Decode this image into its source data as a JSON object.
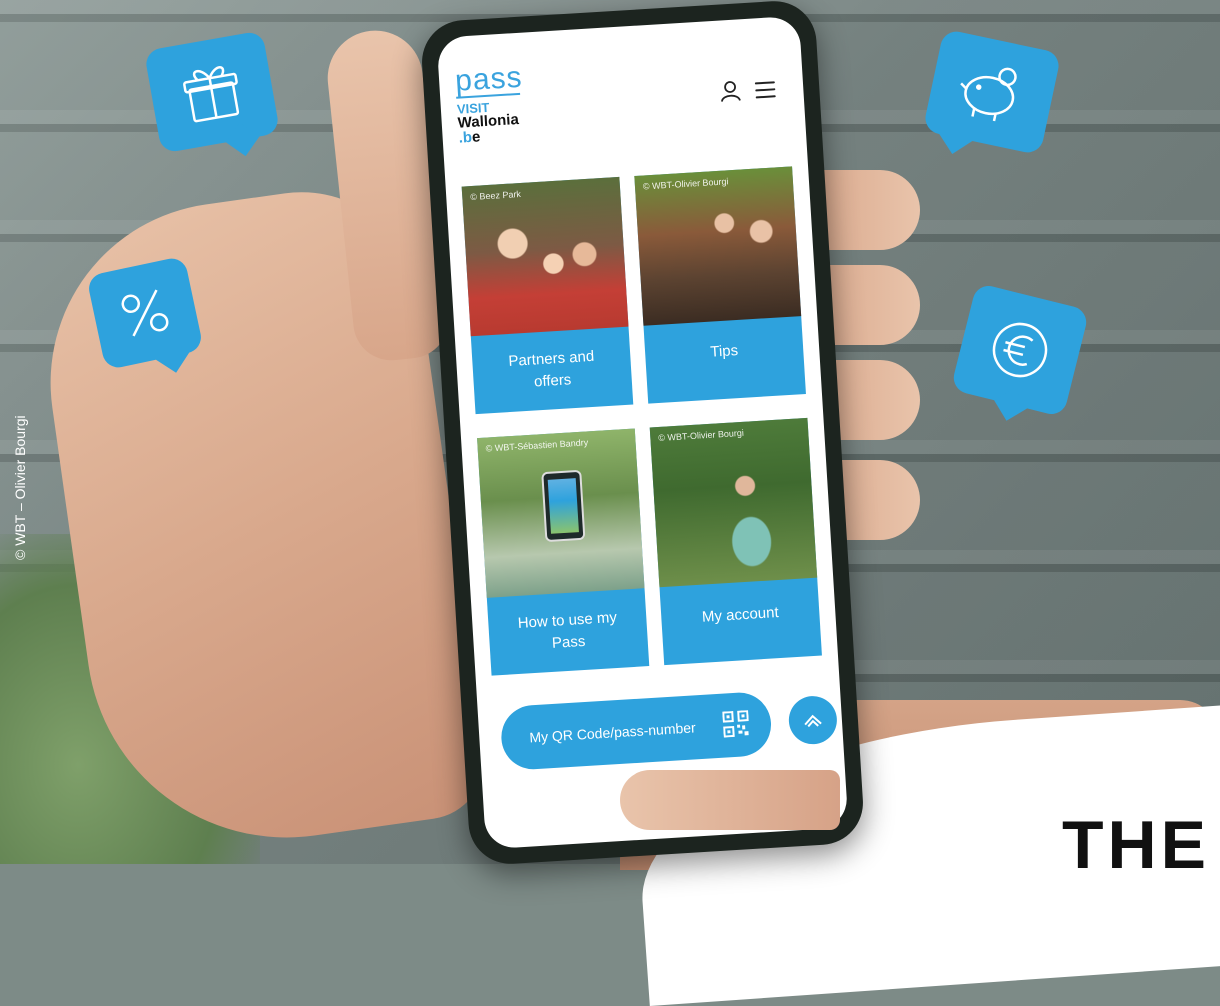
{
  "photo_credit_side": "© WBT – Olivier Bourgi",
  "corner_text": "THE",
  "app": {
    "logo": {
      "pass": "pass",
      "visit": "VISIT",
      "wallonia": "Wallonia",
      "be": ".be"
    },
    "header_icons": [
      "user-icon",
      "menu-icon"
    ],
    "tiles": [
      {
        "label": "Partners and offers",
        "credit": "© Beez Park"
      },
      {
        "label": "Tips",
        "credit": "© WBT-Olivier Bourgi"
      },
      {
        "label": "How to use my Pass",
        "credit": "© WBT-Sébastien Bandry"
      },
      {
        "label": "My account",
        "credit": "© WBT-Olivier Bourgi"
      }
    ],
    "qr_button": {
      "label": "My QR Code/pass-number",
      "icon": "qr-code-icon"
    },
    "scroll_top_icon": "chevron-up-icon"
  },
  "floating_icons": [
    "gift-icon",
    "percent-icon",
    "piggy-bank-icon",
    "euro-icon"
  ],
  "colors": {
    "accent": "#2ea2dd",
    "text_dark": "#111111",
    "white": "#ffffff"
  }
}
